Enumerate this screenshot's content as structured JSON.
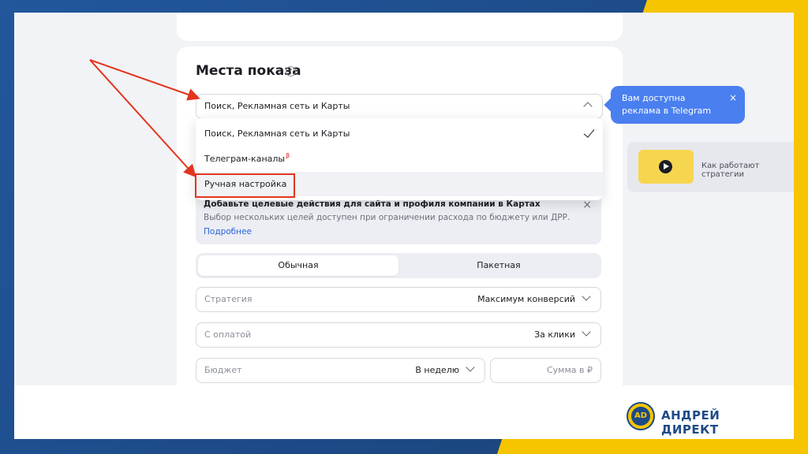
{
  "section": {
    "title": "Места показа",
    "help_icon": "question-circle-icon"
  },
  "placement_select": {
    "value": "Поиск, Рекламная сеть и Карты"
  },
  "dropdown": {
    "items": [
      {
        "label": "Поиск, Рекламная сеть и Карты",
        "selected": true
      },
      {
        "label": "Телеграм-каналы",
        "badge": "β"
      },
      {
        "label": "Ручная настройка",
        "highlighted": true
      }
    ]
  },
  "tooltip": {
    "text": "Вам доступна реклама в Telegram",
    "close": "×"
  },
  "notice": {
    "heading": "Добавьте целевые действия для сайта и профиля компании в Картах",
    "text": "Выбор нескольких целей доступен при ограничении расхода по бюджету или ДРР.",
    "link": "Подробнее",
    "close": "×"
  },
  "segmented": {
    "tabs": [
      "Обычная",
      "Пакетная"
    ],
    "active": "Обычная"
  },
  "fields": {
    "strategy": {
      "label": "Стратегия",
      "value": "Максимум конверсий"
    },
    "payment": {
      "label": "С оплатой",
      "value": "За клики"
    },
    "budget": {
      "label": "Бюджет",
      "value": "В неделю"
    },
    "amount": {
      "placeholder": "Сумма в ₽"
    }
  },
  "side_panel": {
    "text": "Как работают стратегии"
  },
  "branding": {
    "logo_text": "АНДРЕЙ ДИРЕКТ",
    "logo_mark": "AD",
    "colors": {
      "blue": "#1d4a86",
      "yellow": "#f6c500",
      "accent_red": "#e2351f",
      "tooltip_blue": "#4a7ff0"
    }
  }
}
